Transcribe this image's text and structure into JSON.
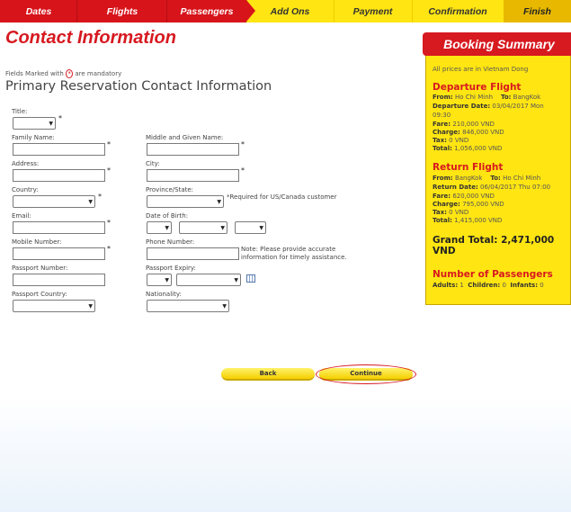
{
  "steps": [
    {
      "label": "Dates",
      "state": "done"
    },
    {
      "label": "Flights",
      "state": "done"
    },
    {
      "label": "Passengers",
      "state": "done"
    },
    {
      "label": "Add Ons",
      "state": "todo"
    },
    {
      "label": "Payment",
      "state": "todo"
    },
    {
      "label": "Confirmation",
      "state": "todo"
    },
    {
      "label": "Finish",
      "state": "todo"
    }
  ],
  "page": {
    "title": "Contact Information",
    "mandatory_prefix": "Fields Marked with",
    "mandatory_star": "*",
    "mandatory_suffix": "are mandatory",
    "subtitle": "Primary Reservation Contact Information"
  },
  "form": {
    "title_label": "Title:",
    "family_label": "Family Name:",
    "given_label": "Middle and Given Name:",
    "address_label": "Address:",
    "city_label": "City:",
    "country_label": "Country:",
    "province_label": "Province/State:",
    "province_note": "*Required for US/Canada customer",
    "email_label": "Email:",
    "dob_label": "Date of Birth:",
    "mobile_label": "Mobile Number:",
    "phone_label": "Phone Number:",
    "phone_note_1": "Note: Please provide accurate",
    "phone_note_2": "information for timely assistance.",
    "passport_label": "Passport Number:",
    "expiry_label": "Passport Expiry:",
    "passport_country_label": "Passport Country:",
    "nationality_label": "Nationality:",
    "star": "*"
  },
  "buttons": {
    "back": "Back",
    "continue": "Continue"
  },
  "summary": {
    "title": "Booking Summary",
    "currency_note": "All prices are in Vietnam Dong",
    "departure": {
      "heading": "Departure Flight",
      "from_label": "From:",
      "from": "Ho Chi Minh",
      "to_label": "To:",
      "to": "BangKok",
      "date_label": "Departure Date:",
      "date": "03/04/2017 Mon",
      "time": "09:30",
      "fare_label": "Fare:",
      "fare": "210,000 VND",
      "charge_label": "Charge:",
      "charge": "846,000 VND",
      "tax_label": "Tax:",
      "tax": "0 VND",
      "total_label": "Total:",
      "total": "1,056,000 VND"
    },
    "return": {
      "heading": "Return Flight",
      "from_label": "From:",
      "from": "BangKok",
      "to_label": "To:",
      "to": "Ho Chi Minh",
      "date_label": "Return Date:",
      "date": "06/04/2017 Thu 07:00",
      "fare_label": "Fare:",
      "fare": "620,000 VND",
      "charge_label": "Charge:",
      "charge": "795,000 VND",
      "tax_label": "Tax:",
      "tax": "0 VND",
      "total_label": "Total:",
      "total": "1,415,000 VND"
    },
    "grand_total_label": "Grand Total:",
    "grand_total": "2,471,000 VND",
    "passengers": {
      "heading": "Number of Passengers",
      "adults_label": "Adults:",
      "adults": "1",
      "children_label": "Children:",
      "children": "0",
      "infants_label": "Infants:",
      "infants": "0"
    }
  },
  "colors": {
    "brand_red": "#d71920",
    "brand_yellow": "#ffe512"
  }
}
